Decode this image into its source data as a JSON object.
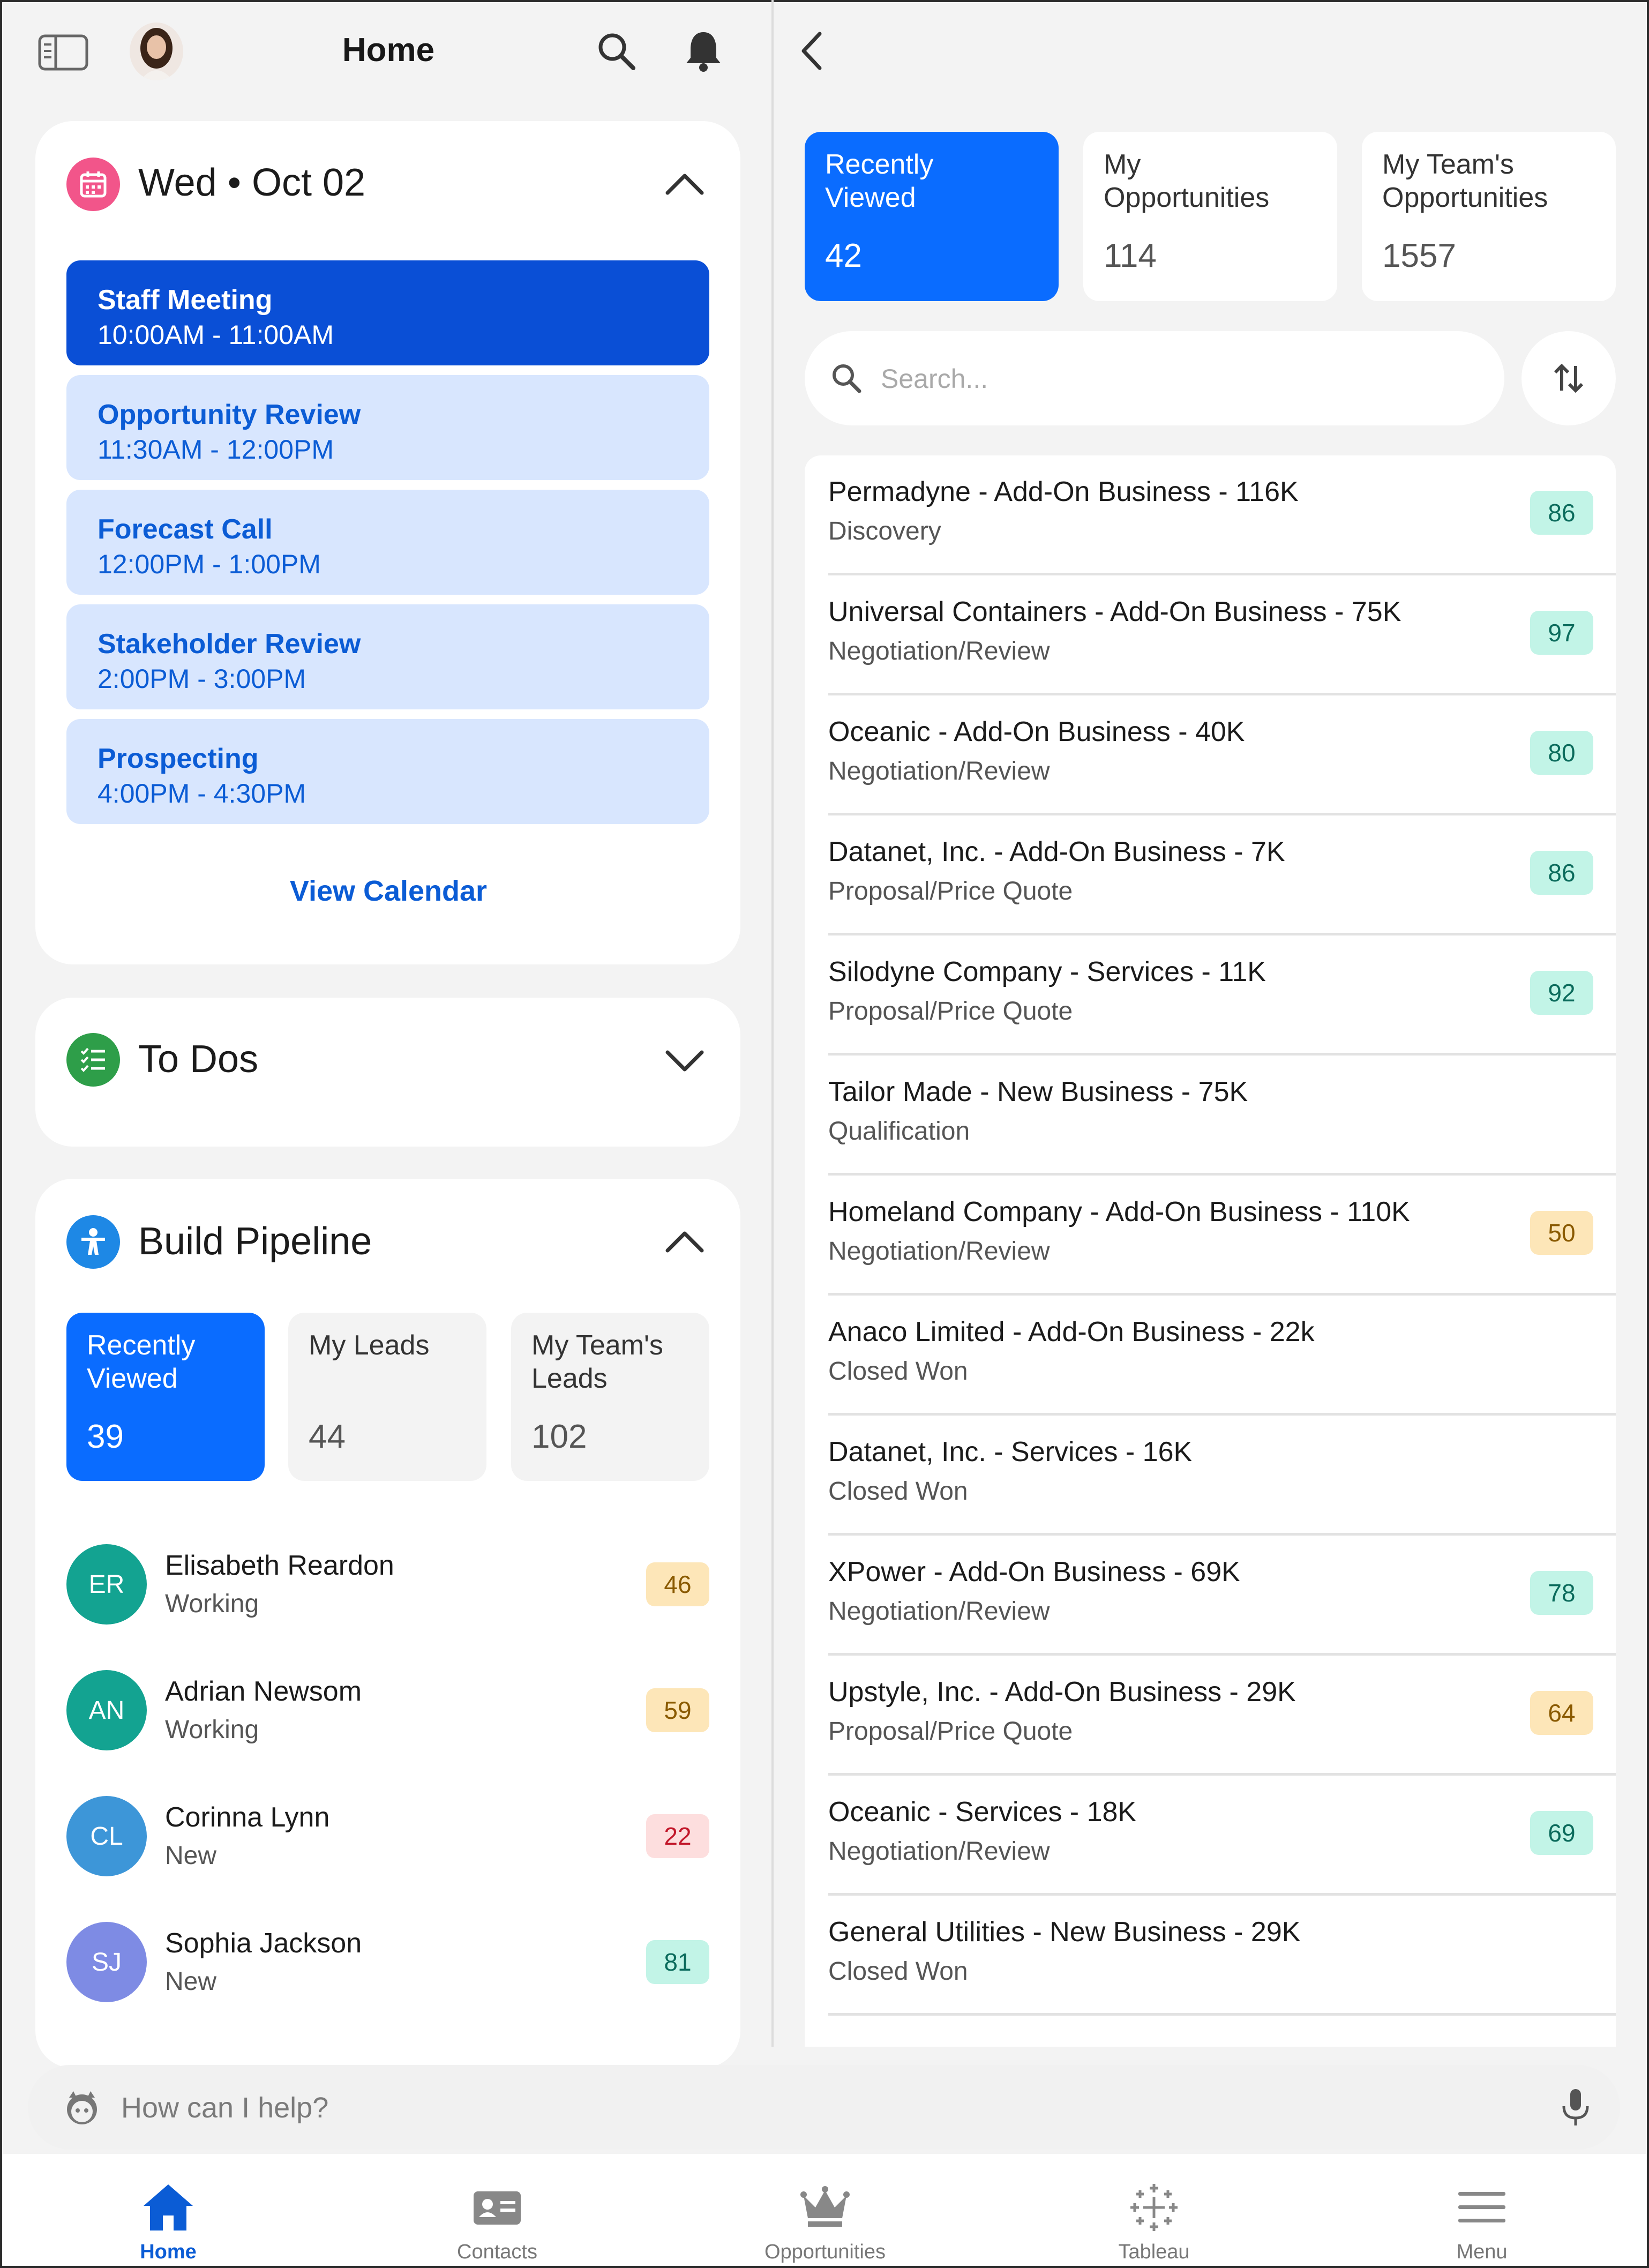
{
  "header": {
    "title": "Home"
  },
  "calendar": {
    "date": "Wed • Oct 02",
    "events": [
      {
        "title": "Staff Meeting",
        "time": "10:00AM - 11:00AM"
      },
      {
        "title": "Opportunity Review",
        "time": "11:30AM - 12:00PM"
      },
      {
        "title": "Forecast Call",
        "time": "12:00PM - 1:00PM"
      },
      {
        "title": "Stakeholder Review",
        "time": "2:00PM - 3:00PM"
      },
      {
        "title": "Prospecting",
        "time": "4:00PM - 4:30PM"
      }
    ],
    "view_calendar": "View Calendar"
  },
  "todos": {
    "title": "To Dos"
  },
  "pipeline": {
    "title": "Build Pipeline",
    "tiles": [
      {
        "label": "Recently Viewed",
        "count": "39"
      },
      {
        "label": "My Leads",
        "count": "44"
      },
      {
        "label": "My Team's Leads",
        "count": "102"
      }
    ],
    "leads": [
      {
        "initials": "ER",
        "name": "Elisabeth Reardon",
        "status": "Working",
        "score": "46",
        "color": "#13a391"
      },
      {
        "initials": "AN",
        "name": "Adrian Newsom",
        "status": "Working",
        "score": "59",
        "color": "#13a391"
      },
      {
        "initials": "CL",
        "name": "Corinna Lynn",
        "status": "New",
        "score": "22",
        "color": "#3d96d8"
      },
      {
        "initials": "SJ",
        "name": "Sophia Jackson",
        "status": "New",
        "score": "81",
        "color": "#7e8be4"
      }
    ]
  },
  "opportunities": {
    "tiles": [
      {
        "label": "Recently Viewed",
        "count": "42"
      },
      {
        "label": "My Opportunities",
        "count": "114"
      },
      {
        "label": "My Team's Opportunities",
        "count": "1557"
      }
    ],
    "search_placeholder": "Search...",
    "items": [
      {
        "name": "Permadyne - Add-On Business - 116K",
        "stage": "Discovery",
        "score": "86"
      },
      {
        "name": "Universal Containers - Add-On Business - 75K",
        "stage": "Negotiation/Review",
        "score": "97"
      },
      {
        "name": "Oceanic - Add-On Business - 40K",
        "stage": "Negotiation/Review",
        "score": "80"
      },
      {
        "name": "Datanet, Inc. - Add-On Business - 7K",
        "stage": "Proposal/Price Quote",
        "score": "86"
      },
      {
        "name": "Silodyne Company - Services - 11K",
        "stage": "Proposal/Price Quote",
        "score": "92"
      },
      {
        "name": "Tailor Made - New Business - 75K",
        "stage": "Qualification",
        "score": ""
      },
      {
        "name": "Homeland Company - Add-On Business - 110K",
        "stage": "Negotiation/Review",
        "score": "50"
      },
      {
        "name": "Anaco Limited - Add-On Business - 22k",
        "stage": "Closed Won",
        "score": ""
      },
      {
        "name": "Datanet, Inc. - Services - 16K",
        "stage": "Closed Won",
        "score": ""
      },
      {
        "name": "XPower - Add-On Business - 69K",
        "stage": "Negotiation/Review",
        "score": "78"
      },
      {
        "name": "Upstyle, Inc. - Add-On Business - 29K",
        "stage": "Proposal/Price Quote",
        "score": "64"
      },
      {
        "name": "Oceanic - Services - 18K",
        "stage": "Negotiation/Review",
        "score": "69"
      },
      {
        "name": "General Utilities - New Business - 29K",
        "stage": "Closed Won",
        "score": ""
      }
    ]
  },
  "assistant": {
    "placeholder": "How can I help?"
  },
  "tabbar": {
    "tabs": [
      {
        "label": "Home",
        "icon": "home-icon"
      },
      {
        "label": "Contacts",
        "icon": "contacts-icon"
      },
      {
        "label": "Opportunities",
        "icon": "crown-icon"
      },
      {
        "label": "Tableau",
        "icon": "tableau-icon"
      },
      {
        "label": "Menu",
        "icon": "menu-icon"
      }
    ]
  },
  "colors": {
    "accent": "#0a6cff",
    "score_high_bg": "#c2f4e7",
    "score_high_fg": "#0b6b5c",
    "score_mid_bg": "#fde6b8",
    "score_mid_fg": "#8a5a00",
    "score_low_bg": "#fddede",
    "score_low_fg": "#c2182b"
  }
}
